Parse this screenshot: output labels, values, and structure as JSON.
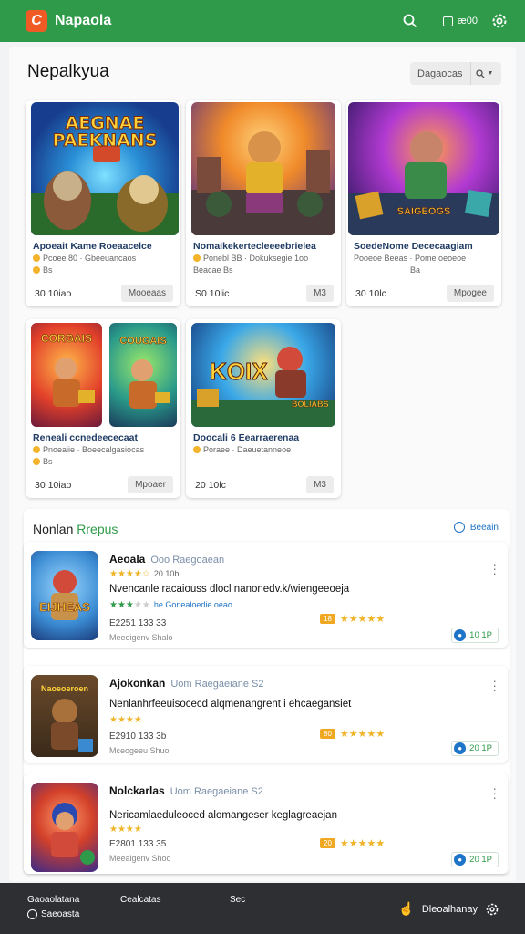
{
  "header": {
    "logo_letter": "C",
    "app_title": "Napaola",
    "account_label": "æ00"
  },
  "page": {
    "title": "Nepalkyua",
    "sort_label": "Dagaocas"
  },
  "games": [
    {
      "art_title": "AEGNAE PAEKNANS",
      "title": "Apoeait Kame Roeaacelce",
      "meta1": "Pcoee 80 · Gbeeuancaos",
      "meta2": "Bs",
      "price": "30 10iao",
      "button": "Mooeaas"
    },
    {
      "art_title": "",
      "title": "Nomaikekertecleeeebrielea",
      "meta1": "Ponebl BB · Dokuksegie 1oo",
      "meta2": "Beacae Bs",
      "price": "S0 10lic",
      "button": "M3"
    },
    {
      "art_title": "SAIGEOGS",
      "title": "SoedeNome Dececaagiam",
      "meta1": "Pooeoe Beeas · Pome oeoeoe",
      "meta2": "Ba",
      "price": "30 10lc",
      "button": "Mpogee"
    },
    {
      "art_title": "CORGAIS · COUGAIS",
      "title": "Reneali ccnedeececaat",
      "meta1": "Pnoeaiie · Boeecalgasiocas",
      "meta2": "Bs",
      "price": "30 10iao",
      "button": "Mpoaer"
    },
    {
      "art_title": "KOIX BOLIABS",
      "title": "Doocali 6 Eearraerenaa",
      "meta1": "Poraee · Daeuetanneoe",
      "meta2": "",
      "price": "20 10lc",
      "button": "M3"
    }
  ],
  "news": {
    "title_main": "Nonlan",
    "title_accent": "Rrepus",
    "link_label": "Beeain",
    "items": [
      {
        "name": "Aeoala",
        "sub": "Ooo Raegoaean",
        "stars1": "★★★★☆",
        "stars1_text": "20 10b",
        "desc": "Nvencanle racaiouss dlocl nanonedv.k/wiengeeoeja",
        "stars2_text": "he Gonealoedie oeao",
        "stat": "E2251 133 33",
        "small": "Meeeigenv Shalo",
        "rating": "★★★★★",
        "badge": "18",
        "pill": "10 1P"
      },
      {
        "name": "Ajokonkan",
        "sub": "Uom Raegaeiane S2",
        "stars1": "★★★★",
        "stars1_text": "",
        "desc": "Nenlanhrfeeuisocecd alqmenangrent i ehcaegansiet",
        "stars2_text": "",
        "stat": "E2910 133 3b",
        "small": "Mceogeeu Shuo",
        "rating": "★★★★★",
        "badge": "80",
        "pill": "20 1P"
      },
      {
        "name": "Nolckarlas",
        "sub": "Uom Raegaeiane S2",
        "stars1": "★★★★",
        "stars1_text": "",
        "desc": "Nericamlaeduleoced alomangeser keglagreaejan",
        "stars2_text": "",
        "stat": "E2801 133 35",
        "small": "Meeaigenv Shoo",
        "rating": "★★★★★",
        "badge": "20",
        "pill": "20 1P"
      }
    ]
  },
  "bottom_nav": {
    "tab1": "Gaoaolatana",
    "tab2": "Cealcatas",
    "tab3": "Sec",
    "sub_label": "Saeoasta",
    "right_label": "Dleoalhanay"
  }
}
